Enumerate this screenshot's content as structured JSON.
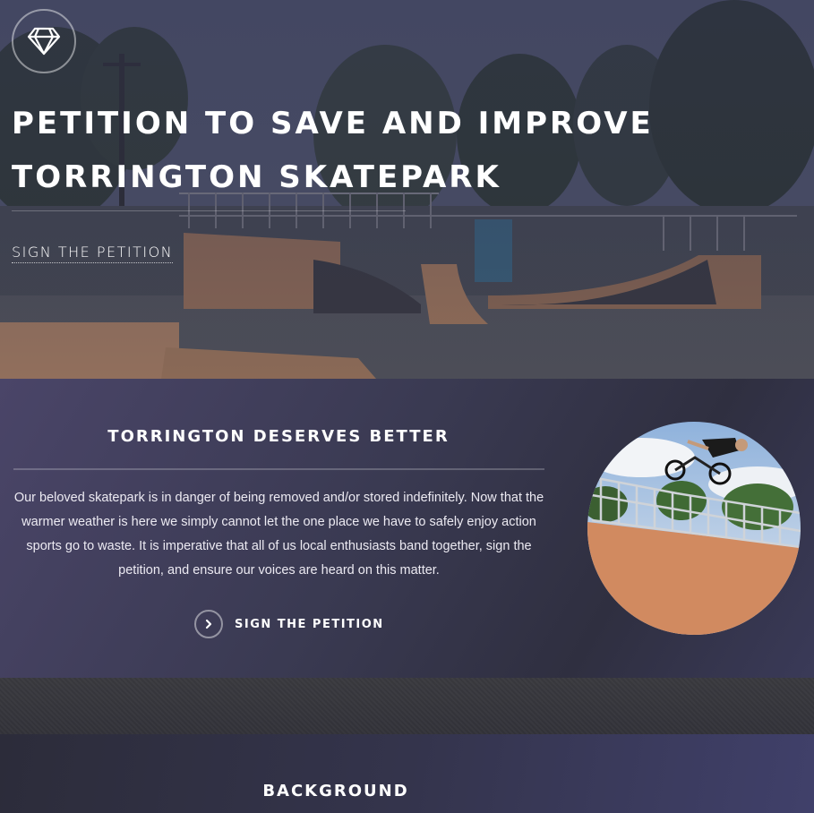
{
  "hero": {
    "logo_icon": "diamond-icon",
    "title_line1": "PETITION TO SAVE AND IMPROVE",
    "title_line2": "TORRINGTON SKATEPARK",
    "link_label": "SIGN THE PETITION"
  },
  "intro": {
    "heading": "TORRINGTON DESERVES BETTER",
    "body": "Our beloved skatepark is in danger of being removed and/or stored indefinitely. Now that the warmer weather is here we simply cannot let the one place we have to safely enjoy action sports go to waste. It is imperative that all of us local enthusiasts band together, sign the petition, and ensure our voices are heard on this matter.",
    "cta_icon": "chevron-right-icon",
    "cta_label": "SIGN THE PETITION"
  },
  "background_section": {
    "heading": "BACKGROUND"
  }
}
